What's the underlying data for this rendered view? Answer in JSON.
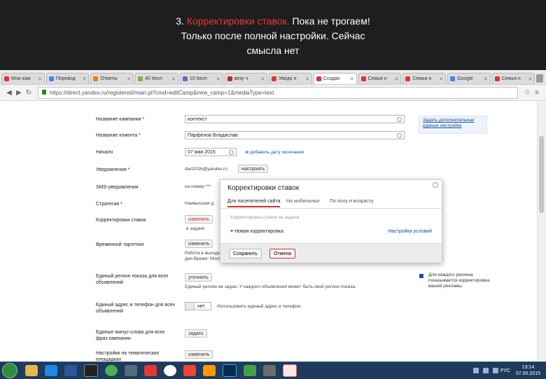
{
  "caption": {
    "line1_prefix": "3. ",
    "line1_highlight": "Корректировки ставок.",
    "line1_rest": " Пока не трогаем!",
    "line2": "Только после полной настройки. Сейчас",
    "line3": "смысла нет"
  },
  "tabs": [
    {
      "label": "Мои кам"
    },
    {
      "label": "Перевод"
    },
    {
      "label": "Ответы"
    },
    {
      "label": "40 бесп"
    },
    {
      "label": "10 бесп"
    },
    {
      "label": "везу ч"
    },
    {
      "label": "Уведо н"
    },
    {
      "label": "Создан"
    },
    {
      "label": "Семья н"
    },
    {
      "label": "Семья н"
    },
    {
      "label": "Google"
    },
    {
      "label": "Семья н"
    }
  ],
  "address_bar": {
    "url": "https://direct.yandex.ru/registered/main.pl?cmd=editCamp&new_camp=1&mediaType=text"
  },
  "form": {
    "campaign_name_label": "Название кампании *",
    "campaign_name_value": "контекст",
    "client_name_label": "Название клиента *",
    "client_name_value": "Парфенов Владислав",
    "start_label": "Начало",
    "start_value": "07 мая 2015",
    "end_link": "добавить дату окончания",
    "notifications_label": "Уведомления *",
    "notifications_email": "dart2016@yandex.ru",
    "notifications_button": "настроить",
    "sms_label": "SMS-уведомления",
    "sms_value": "на номер ***",
    "strategy_label": "Стратегия *",
    "strategy_value": "Наивысшая д",
    "bid_adj_label": "Корректировки ставок",
    "bid_adj_button": "изменить",
    "bid_adj_note": "в задаче",
    "targeting_label": "Временной таргетинг",
    "targeting_button": "изменить",
    "targeting_note": "Работа в выходные дни Время: Москва",
    "region_label": "Единый регион показа для всех объявлений",
    "region_button": "уточнить",
    "region_note": "Единый регион не задан. У каждого объявления может быть свой регион показа.",
    "region_hint": "Для каждого региона показывается корректировка вашей рекламы",
    "address_label": "Единый адрес и телефон для всех объявлений",
    "address_toggle": "нет",
    "address_note": "Использовать единый адрес и телефон",
    "keywords_label": "Единые минус-слова для всех фраз кампании",
    "keywords_button": "задать",
    "thematic_label": "Настройки на тематических площадках",
    "thematic_button": "изменить",
    "side_link": "Задать дополнительные единые настройки"
  },
  "modal": {
    "title": "Корректировки ставок",
    "tabs": [
      "Для посетителей сайта",
      "На мобильных",
      "По полу и возрасту"
    ],
    "section_label": "Корректировка ставок не задана",
    "new_adjustment": "Новая корректировка",
    "conditions_link": "Настройка условий",
    "save_button": "Сохранить",
    "cancel_button": "Отмена"
  },
  "taskbar": {
    "lang": "РУС",
    "time": "13:14",
    "date": "07.05.2015"
  }
}
